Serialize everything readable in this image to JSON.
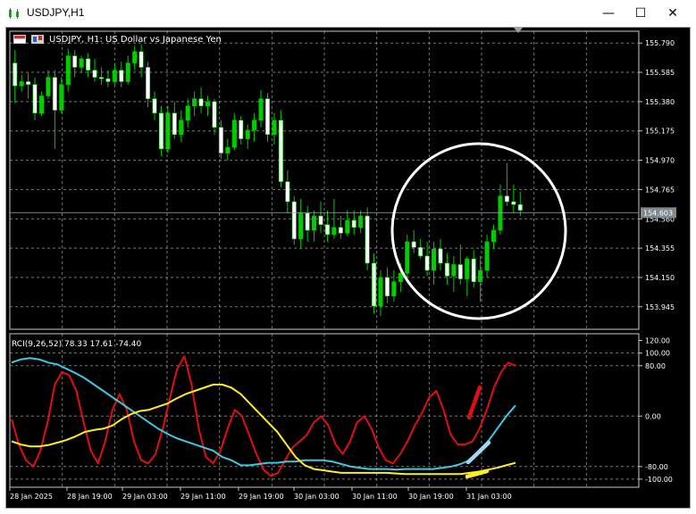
{
  "window": {
    "title": "USDJPY,H1",
    "minimize_glyph": "—",
    "maximize_glyph": "☐",
    "close_glyph": "✕",
    "icon": "chart-window-icon"
  },
  "chart": {
    "label": "USDJPY, H1:  US Dollar vs Japanese Yen",
    "bg": "#000000",
    "up_color": "#00cc00",
    "down_color": "#ffffff",
    "grid_color": "#c8c8c8"
  },
  "indicator": {
    "label": "RCI(9,26,52) 78.33 17.61 -74.40",
    "colors": {
      "fast": "#e01010",
      "mid": "#40c8e0",
      "slow": "#ffee22"
    }
  },
  "annotation": {
    "shape": "circle",
    "color": "#ffffff"
  },
  "chart_data": [
    {
      "type": "candlestick",
      "title": "USDJPY, H1:  US Dollar vs Japanese Yen",
      "ylim": [
        153.8,
        155.86
      ],
      "yticks": [
        155.79,
        155.585,
        155.38,
        155.175,
        154.97,
        154.765,
        154.56,
        154.355,
        154.15,
        153.945
      ],
      "ytick_labels": [
        "155.790",
        "155.585",
        "155.380",
        "155.175",
        "154.970",
        "154.765",
        "154.560",
        "154.355",
        "154.150",
        "153.945"
      ],
      "current_price": 154.603,
      "current_price_label": "154.603",
      "x_labels": [
        "28 Jan 2025",
        "28 Jan 19:00",
        "29 Jan 03:00",
        "29 Jan 11:00",
        "29 Jan 19:00",
        "30 Jan 03:00",
        "30 Jan 11:00",
        "30 Jan 19:00",
        "31 Jan 03:00"
      ],
      "candles": [
        [
          155.65,
          155.74,
          155.37,
          155.49
        ],
        [
          155.49,
          155.57,
          155.45,
          155.52
        ],
        [
          155.52,
          155.58,
          155.4,
          155.5
        ],
        [
          155.5,
          155.55,
          155.25,
          155.3
        ],
        [
          155.3,
          155.45,
          155.28,
          155.42
        ],
        [
          155.42,
          155.6,
          155.4,
          155.55
        ],
        [
          155.55,
          155.6,
          155.05,
          155.32
        ],
        [
          155.32,
          155.55,
          155.3,
          155.5
        ],
        [
          155.5,
          155.75,
          155.45,
          155.7
        ],
        [
          155.7,
          155.74,
          155.55,
          155.62
        ],
        [
          155.62,
          155.7,
          155.58,
          155.68
        ],
        [
          155.68,
          155.72,
          155.55,
          155.6
        ],
        [
          155.6,
          155.68,
          155.52,
          155.55
        ],
        [
          155.55,
          155.62,
          155.5,
          155.54
        ],
        [
          155.54,
          155.6,
          155.48,
          155.52
        ],
        [
          155.52,
          155.65,
          155.5,
          155.6
        ],
        [
          155.6,
          155.66,
          155.48,
          155.52
        ],
        [
          155.52,
          155.7,
          155.5,
          155.65
        ],
        [
          155.65,
          155.77,
          155.6,
          155.73
        ],
        [
          155.73,
          155.78,
          155.55,
          155.62
        ],
        [
          155.62,
          155.66,
          155.34,
          155.4
        ],
        [
          155.4,
          155.45,
          155.25,
          155.3
        ],
        [
          155.3,
          155.35,
          155.0,
          155.05
        ],
        [
          155.05,
          155.35,
          155.02,
          155.3
        ],
        [
          155.3,
          155.38,
          155.12,
          155.15
        ],
        [
          155.15,
          155.32,
          155.1,
          155.25
        ],
        [
          155.25,
          155.4,
          155.2,
          155.35
        ],
        [
          155.35,
          155.45,
          155.28,
          155.4
        ],
        [
          155.4,
          155.48,
          155.3,
          155.35
        ],
        [
          155.35,
          155.42,
          155.28,
          155.38
        ],
        [
          155.38,
          155.4,
          155.15,
          155.2
        ],
        [
          155.2,
          155.25,
          154.98,
          155.02
        ],
        [
          155.02,
          155.12,
          154.97,
          155.06
        ],
        [
          155.06,
          155.3,
          155.04,
          155.25
        ],
        [
          155.25,
          155.28,
          155.08,
          155.12
        ],
        [
          155.12,
          155.22,
          155.05,
          155.18
        ],
        [
          155.18,
          155.3,
          155.1,
          155.25
        ],
        [
          155.25,
          155.46,
          155.2,
          155.4
        ],
        [
          155.4,
          155.44,
          155.1,
          155.15
        ],
        [
          155.15,
          155.3,
          155.08,
          155.25
        ],
        [
          155.25,
          155.32,
          154.78,
          154.82
        ],
        [
          154.82,
          154.9,
          154.6,
          154.68
        ],
        [
          154.68,
          154.72,
          154.38,
          154.42
        ],
        [
          154.42,
          154.7,
          154.35,
          154.6
        ],
        [
          154.6,
          154.65,
          154.4,
          154.48
        ],
        [
          154.48,
          154.62,
          154.4,
          154.58
        ],
        [
          154.58,
          154.68,
          154.46,
          154.52
        ],
        [
          154.52,
          154.62,
          154.4,
          154.45
        ],
        [
          154.45,
          154.7,
          154.42,
          154.5
        ],
        [
          154.5,
          154.58,
          154.42,
          154.46
        ],
        [
          154.46,
          154.62,
          154.44,
          154.55
        ],
        [
          154.55,
          154.62,
          154.45,
          154.5
        ],
        [
          154.5,
          154.62,
          154.46,
          154.58
        ],
        [
          154.58,
          154.64,
          154.2,
          154.25
        ],
        [
          154.25,
          154.32,
          153.9,
          153.95
        ],
        [
          153.95,
          154.2,
          153.88,
          154.15
        ],
        [
          154.15,
          154.22,
          153.97,
          154.02
        ],
        [
          154.02,
          154.2,
          153.98,
          154.12
        ],
        [
          154.12,
          154.25,
          154.05,
          154.18
        ],
        [
          154.18,
          154.45,
          154.15,
          154.4
        ],
        [
          154.4,
          154.48,
          154.32,
          154.36
        ],
        [
          154.36,
          154.42,
          154.28,
          154.3
        ],
        [
          154.3,
          154.4,
          154.16,
          154.2
        ],
        [
          154.2,
          154.4,
          154.1,
          154.35
        ],
        [
          154.35,
          154.42,
          154.2,
          154.25
        ],
        [
          154.25,
          154.32,
          154.1,
          154.16
        ],
        [
          154.16,
          154.3,
          154.05,
          154.24
        ],
        [
          154.24,
          154.38,
          154.1,
          154.14
        ],
        [
          154.14,
          154.3,
          154.02,
          154.28
        ],
        [
          154.28,
          154.34,
          154.08,
          154.12
        ],
        [
          154.12,
          154.3,
          153.98,
          154.2
        ],
        [
          154.2,
          154.45,
          154.15,
          154.4
        ],
        [
          154.4,
          154.52,
          154.35,
          154.48
        ],
        [
          154.48,
          154.8,
          154.45,
          154.72
        ],
        [
          154.72,
          154.95,
          154.65,
          154.68
        ],
        [
          154.68,
          154.8,
          154.6,
          154.66
        ],
        [
          154.66,
          154.75,
          154.58,
          154.62
        ]
      ]
    },
    {
      "type": "line",
      "title": "RCI(9,26,52) 78.33 17.61 -74.40",
      "ylim": [
        -110,
        125
      ],
      "yticks": [
        120,
        100,
        80,
        0,
        -80,
        -100
      ],
      "ytick_labels": [
        "120.00",
        "100.00",
        "80.00",
        "0.00",
        "-80.00",
        "-100.00"
      ],
      "series": [
        {
          "name": "RCI 9",
          "color": "#e01010",
          "values": [
            -5,
            -45,
            -70,
            -80,
            -55,
            -10,
            50,
            70,
            65,
            40,
            -10,
            -55,
            -75,
            -40,
            10,
            35,
            10,
            -40,
            -70,
            -75,
            -60,
            -20,
            30,
            75,
            95,
            50,
            -20,
            -65,
            -75,
            -55,
            -20,
            10,
            0,
            -30,
            -60,
            -85,
            -95,
            -90,
            -70,
            -50,
            -40,
            -30,
            -10,
            0,
            -15,
            -45,
            -60,
            -40,
            -10,
            0,
            -20,
            -50,
            -70,
            -75,
            -60,
            -40,
            -15,
            5,
            30,
            40,
            10,
            -30,
            -45,
            -45,
            -40,
            -20,
            10,
            45,
            70,
            85,
            80
          ]
        },
        {
          "name": "RCI 26",
          "color": "#40c8e0",
          "values": [
            85,
            90,
            92,
            90,
            85,
            82,
            75,
            68,
            60,
            50,
            40,
            30,
            20,
            10,
            0,
            -10,
            -20,
            -28,
            -35,
            -40,
            -45,
            -50,
            -55,
            -65,
            -70,
            -78,
            -78,
            -76,
            -74,
            -74,
            -72,
            -72,
            -70,
            -70,
            -70,
            -72,
            -76,
            -80,
            -82,
            -84,
            -84,
            -84,
            -85,
            -84,
            -84,
            -84,
            -84,
            -82,
            -80,
            -76,
            -70,
            -55,
            -40,
            -20,
            0,
            17
          ]
        },
        {
          "name": "RCI 52",
          "color": "#ffee22",
          "values": [
            -40,
            -45,
            -48,
            -48,
            -46,
            -42,
            -38,
            -32,
            -25,
            -22,
            -20,
            -15,
            -5,
            3,
            8,
            10,
            15,
            20,
            28,
            35,
            40,
            45,
            50,
            50,
            45,
            35,
            20,
            5,
            -10,
            -25,
            -45,
            -65,
            -78,
            -84,
            -86,
            -88,
            -90,
            -90,
            -90,
            -90,
            -90,
            -90,
            -91,
            -92,
            -92,
            -92,
            -92,
            -92,
            -92,
            -92,
            -90,
            -88,
            -85,
            -82,
            -78,
            -74
          ]
        }
      ]
    }
  ]
}
